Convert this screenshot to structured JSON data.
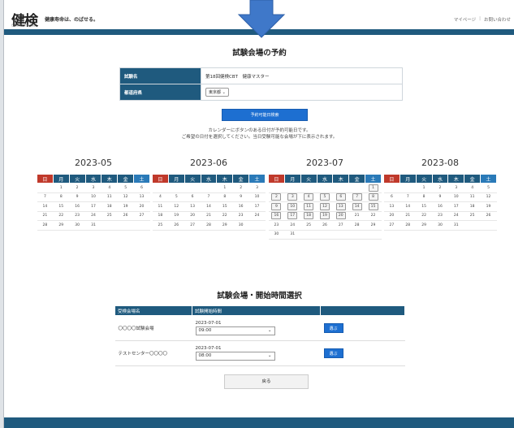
{
  "header": {
    "logo": "健検",
    "logo_sub": "日本健康マスター検定",
    "tagline": "健康寿命は、のばせる。",
    "links": [
      "マイページ",
      "お問い合わせ"
    ]
  },
  "title": "試験会場の予約",
  "form": {
    "exam_label": "試験名",
    "exam_value": "第18回健検CBT　健康マスター",
    "pref_label": "都道府県",
    "pref_value": "東京都"
  },
  "search_button": "予約可能日検索",
  "notice": [
    "カレンダーにボタンのある日付が予約可能日です。",
    "ご希望の日付を選択してください。当日受験可能な会場が下に表示されます。"
  ],
  "weekdays": [
    "日",
    "月",
    "火",
    "水",
    "木",
    "金",
    "土"
  ],
  "calendars": [
    {
      "title": "2023-05",
      "rows": [
        [
          "",
          "1",
          "2",
          "3",
          "4",
          "5",
          "6"
        ],
        [
          "7",
          "8",
          "9",
          "10",
          "11",
          "12",
          "13"
        ],
        [
          "14",
          "15",
          "16",
          "17",
          "18",
          "19",
          "20"
        ],
        [
          "21",
          "22",
          "23",
          "24",
          "25",
          "26",
          "27"
        ],
        [
          "28",
          "29",
          "30",
          "31",
          "",
          "",
          ""
        ]
      ]
    },
    {
      "title": "2023-06",
      "rows": [
        [
          "",
          "",
          "",
          "",
          "1",
          "2",
          "3"
        ],
        [
          "4",
          "5",
          "6",
          "7",
          "8",
          "9",
          "10"
        ],
        [
          "11",
          "12",
          "13",
          "14",
          "15",
          "16",
          "17"
        ],
        [
          "18",
          "19",
          "20",
          "21",
          "22",
          "23",
          "24"
        ],
        [
          "25",
          "26",
          "27",
          "28",
          "29",
          "30",
          ""
        ]
      ]
    },
    {
      "title": "2023-07",
      "available": [
        "1",
        "2",
        "3",
        "4",
        "5",
        "6",
        "7",
        "8",
        "9",
        "10",
        "11",
        "12",
        "13",
        "14",
        "15",
        "16",
        "17",
        "18",
        "19",
        "20"
      ],
      "rows": [
        [
          "",
          "",
          "",
          "",
          "",
          "",
          "1"
        ],
        [
          "2",
          "3",
          "4",
          "5",
          "6",
          "7",
          "8"
        ],
        [
          "9",
          "10",
          "11",
          "12",
          "13",
          "14",
          "15"
        ],
        [
          "16",
          "17",
          "18",
          "19",
          "20",
          "21",
          "22"
        ],
        [
          "23",
          "24",
          "25",
          "26",
          "27",
          "28",
          "29"
        ],
        [
          "30",
          "31",
          "",
          "",
          "",
          "",
          ""
        ]
      ]
    },
    {
      "title": "2023-08",
      "rows": [
        [
          "",
          "",
          "1",
          "2",
          "3",
          "4",
          "5"
        ],
        [
          "6",
          "7",
          "8",
          "9",
          "10",
          "11",
          "12"
        ],
        [
          "13",
          "14",
          "15",
          "16",
          "17",
          "18",
          "19"
        ],
        [
          "20",
          "21",
          "22",
          "23",
          "24",
          "25",
          "26"
        ],
        [
          "27",
          "28",
          "29",
          "30",
          "31",
          "",
          ""
        ]
      ]
    }
  ],
  "venue_section_title": "試験会場・開始時間選択",
  "venue_table": {
    "headers": [
      "受検会場名",
      "試験開始時間",
      ""
    ],
    "rows": [
      {
        "name": "〇〇〇〇試験会場",
        "date": "2023-07-01",
        "time": "09:00",
        "button": "選ぶ"
      },
      {
        "name": "テストセンター〇〇〇〇",
        "date": "2023-07-01",
        "time": "08:00",
        "button": "選ぶ"
      }
    ]
  },
  "back_button": "戻る",
  "colors": {
    "primary": "#1f5a7e",
    "button_blue": "#1d6fd1",
    "sunday": "#c0392b",
    "saturday": "#2a7ab8"
  }
}
